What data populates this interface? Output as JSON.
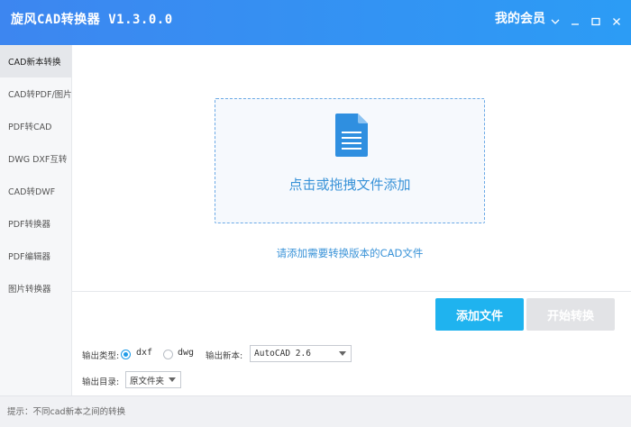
{
  "app": {
    "title": "旋风CAD转换器 V1.3.0.0",
    "member": "我的会员"
  },
  "sidebar": {
    "items": [
      {
        "label": "CAD新本转换"
      },
      {
        "label": "CAD转PDF/图片"
      },
      {
        "label": "PDF转CAD"
      },
      {
        "label": "DWG DXF互转"
      },
      {
        "label": "CAD转DWF"
      },
      {
        "label": "PDF转换器"
      },
      {
        "label": "PDF编辑器"
      },
      {
        "label": "图片转换器"
      }
    ]
  },
  "dropzone": {
    "text": "点击或拖拽文件添加",
    "icon": "document-icon"
  },
  "hint": "请添加需要转换版本的CAD文件",
  "buttons": {
    "add": "添加文件",
    "start": "开始转换"
  },
  "options": {
    "type_label": "输出类型:",
    "type_options": [
      "dxf",
      "dwg"
    ],
    "type_selected": "dxf",
    "version_label": "输出新本:",
    "version_value": "AutoCAD 2.6",
    "dir_label": "输出目录:",
    "dir_value": "原文件夹"
  },
  "status": "提示：不同cad新本之间的转换",
  "colors": {
    "accent": "#1fb3ef",
    "titlebar": "#3d86f0",
    "link": "#3a93d8",
    "disabled": "#e2e3e6"
  }
}
